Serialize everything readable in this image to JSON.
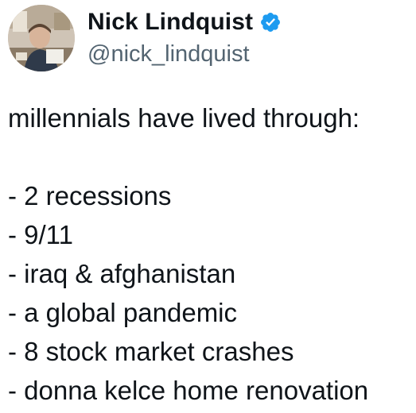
{
  "author": {
    "display_name": "Nick Lindquist",
    "handle": "@nick_lindquist",
    "verified_icon": "verified-badge-icon",
    "verified_color": "#1d9bf0"
  },
  "tweet": {
    "intro": "millennials have lived through:",
    "list": [
      "- 2 recessions",
      "- 9/11",
      "- iraq & afghanistan",
      "- a global pandemic",
      "- 8 stock market crashes",
      "- donna kelce home renovation"
    ]
  },
  "colors": {
    "text": "#0f1419",
    "secondary_text": "#536471",
    "background": "#ffffff"
  }
}
